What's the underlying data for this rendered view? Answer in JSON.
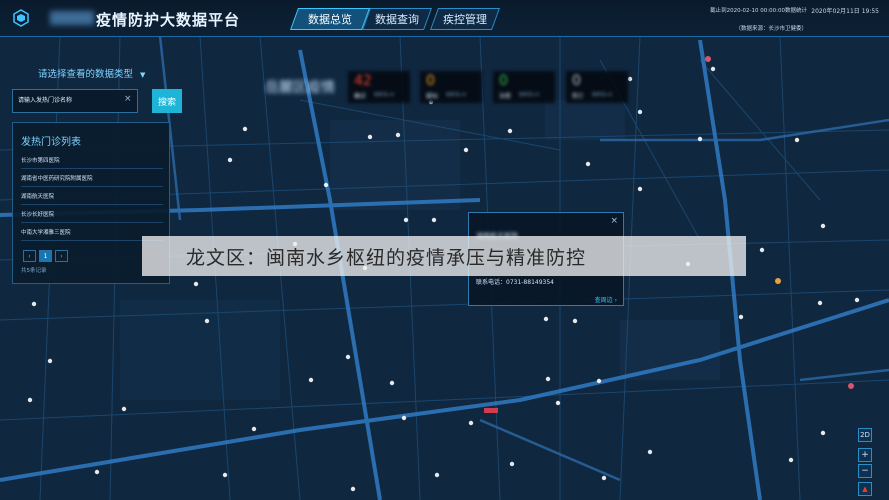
{
  "app": {
    "title": "疫情防护大数据平台",
    "colors": {
      "accent": "#1db4d8",
      "border": "#2a8fc9",
      "map_road": "#2f7bc4",
      "map_bg": "#102740"
    }
  },
  "nav": {
    "tabs": [
      {
        "label": "数据总览",
        "active": true
      },
      {
        "label": "数据查询",
        "active": false
      },
      {
        "label": "疾控管理",
        "active": false
      }
    ]
  },
  "header": {
    "deadline": "截止到2020-02-10 00:00:00数据统计",
    "source": "（数据来源：长沙市卫健委）",
    "datetime": "2020年02月11日 19:55"
  },
  "sidebar": {
    "data_type_label": "请选择查看的数据类型",
    "search": {
      "placeholder": "请输入发热门诊名称",
      "button": "搜索"
    },
    "clinic_list": {
      "title": "发热门诊列表",
      "items": [
        "长沙市第四医院",
        "湖南省中医药研究院附属医院",
        "湖南航天医院",
        "长沙长好医院",
        "中南大学湘雅三医院"
      ],
      "pagination": {
        "prev": "‹",
        "current": "1",
        "next": "›"
      },
      "total": "共5条记录"
    }
  },
  "map": {
    "district": "岳麓区疫情",
    "stats": [
      {
        "value": "42",
        "label": "确诊",
        "sub": "较昨日+0",
        "color": "#e8412c"
      },
      {
        "value": "0",
        "label": "疑似",
        "sub": "较昨日+0",
        "color": "#f0a020"
      },
      {
        "value": "0",
        "label": "治愈",
        "sub": "较昨日+0",
        "color": "#35c24a"
      },
      {
        "value": "0",
        "label": "死亡",
        "sub": "较昨日+0",
        "color": "#b9c3cc"
      }
    ],
    "popup": {
      "title": "湖南航天医院",
      "phone": "联系电话：0731-88149354",
      "link": "查周边",
      "close": "×"
    },
    "controls": {
      "mode": "2D",
      "zoom_in": "+",
      "zoom_out": "−",
      "compass": "▲"
    }
  },
  "caption": {
    "text": "龙文区：闽南水乡枢纽的疫情承压与精准防控"
  }
}
